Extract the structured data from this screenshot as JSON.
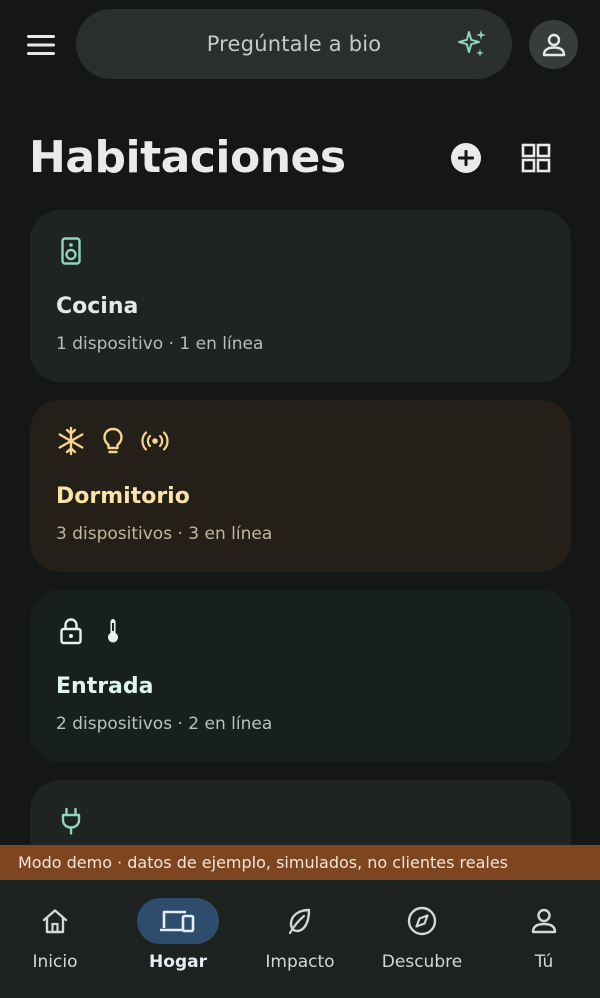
{
  "search": {
    "placeholder": "Pregúntale a bio"
  },
  "page": {
    "title": "Habitaciones"
  },
  "rooms": [
    {
      "name": "Cocina",
      "summary": "1 dispositivo · 1 en línea",
      "icons": [
        "speaker-icon"
      ]
    },
    {
      "name": "Dormitorio",
      "summary": "3 dispositivos · 3 en línea",
      "icons": [
        "snowflake-icon",
        "lightbulb-icon",
        "sensor-icon"
      ]
    },
    {
      "name": "Entrada",
      "summary": "2 dispositivos · 2 en línea",
      "icons": [
        "lock-icon",
        "thermometer-icon"
      ]
    },
    {
      "name": "",
      "summary": "",
      "icons": [
        "plug-icon"
      ]
    }
  ],
  "banner": {
    "text": "Modo demo · datos de ejemplo, simulados, no clientes reales"
  },
  "nav": [
    {
      "label": "Inicio",
      "icon": "home-icon",
      "active": false
    },
    {
      "label": "Hogar",
      "icon": "devices-icon",
      "active": true
    },
    {
      "label": "Impacto",
      "icon": "leaf-icon",
      "active": false
    },
    {
      "label": "Descubre",
      "icon": "compass-icon",
      "active": false
    },
    {
      "label": "Tú",
      "icon": "person-icon",
      "active": false
    }
  ],
  "colors": {
    "background": "#141716",
    "search_bg": "#2a2e2c",
    "accent_teal": "#8fd4c0",
    "accent_amber": "#f6d58d",
    "banner_bg": "#7e4620",
    "nav_active_bg": "#2e4d6c"
  }
}
